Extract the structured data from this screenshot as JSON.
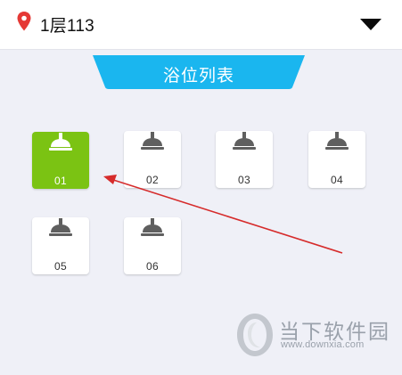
{
  "header": {
    "location_icon": "map-pin-icon",
    "location_text": "1层113",
    "dropdown_icon": "caret-down-icon"
  },
  "banner": {
    "title": "浴位列表"
  },
  "stalls": [
    {
      "label": "01",
      "selected": true,
      "icon": "shower-head-icon"
    },
    {
      "label": "02",
      "selected": false,
      "icon": "shower-head-icon"
    },
    {
      "label": "03",
      "selected": false,
      "icon": "shower-head-icon"
    },
    {
      "label": "04",
      "selected": false,
      "icon": "shower-head-icon"
    },
    {
      "label": "05",
      "selected": false,
      "icon": "shower-head-icon"
    },
    {
      "label": "06",
      "selected": false,
      "icon": "shower-head-icon"
    }
  ],
  "annotation": {
    "icon": "red-arrow-pointer"
  },
  "watermark": {
    "name": "当下软件园",
    "url": "www.downxia.com"
  },
  "colors": {
    "accent_blue": "#1ab6ef",
    "selected_green": "#7bc313",
    "pin_red": "#e53935",
    "arrow_red": "#d62b2b",
    "background": "#eff0f7"
  }
}
